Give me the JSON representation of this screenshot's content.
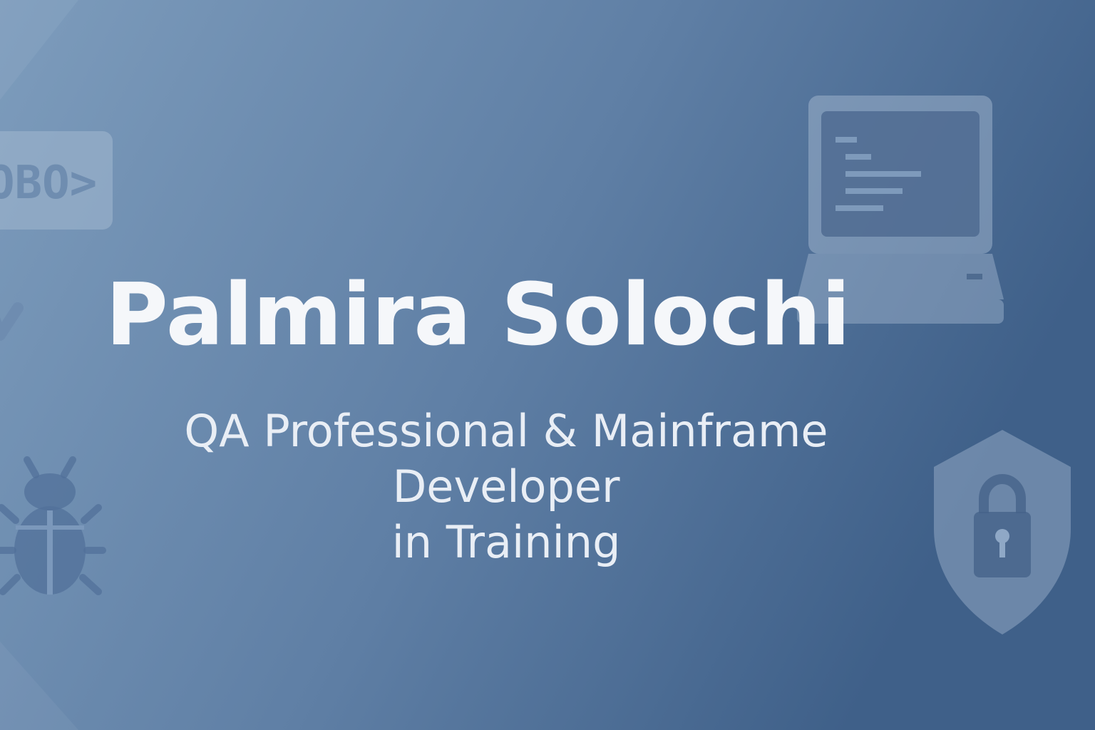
{
  "colors": {
    "gradient_start": "#7d9cbc",
    "gradient_mid": "#5f7fa5",
    "gradient_end": "#3f6089",
    "title_text": "#f5f7fa",
    "subtitle_text": "#e9eef5",
    "icon_light": "#a3b8d0",
    "icon_dark": "#46638a"
  },
  "banner": {
    "title": "Palmira Solochi",
    "subtitle_line1": "QA Professional & Mainframe Developer",
    "subtitle_line2": "in Training"
  },
  "decorations": {
    "cobol_badge_text": "OBO>",
    "icons": [
      "cobol-badge-icon",
      "checkmark-icon",
      "bug-icon",
      "laptop-code-icon",
      "shield-lock-icon"
    ]
  }
}
